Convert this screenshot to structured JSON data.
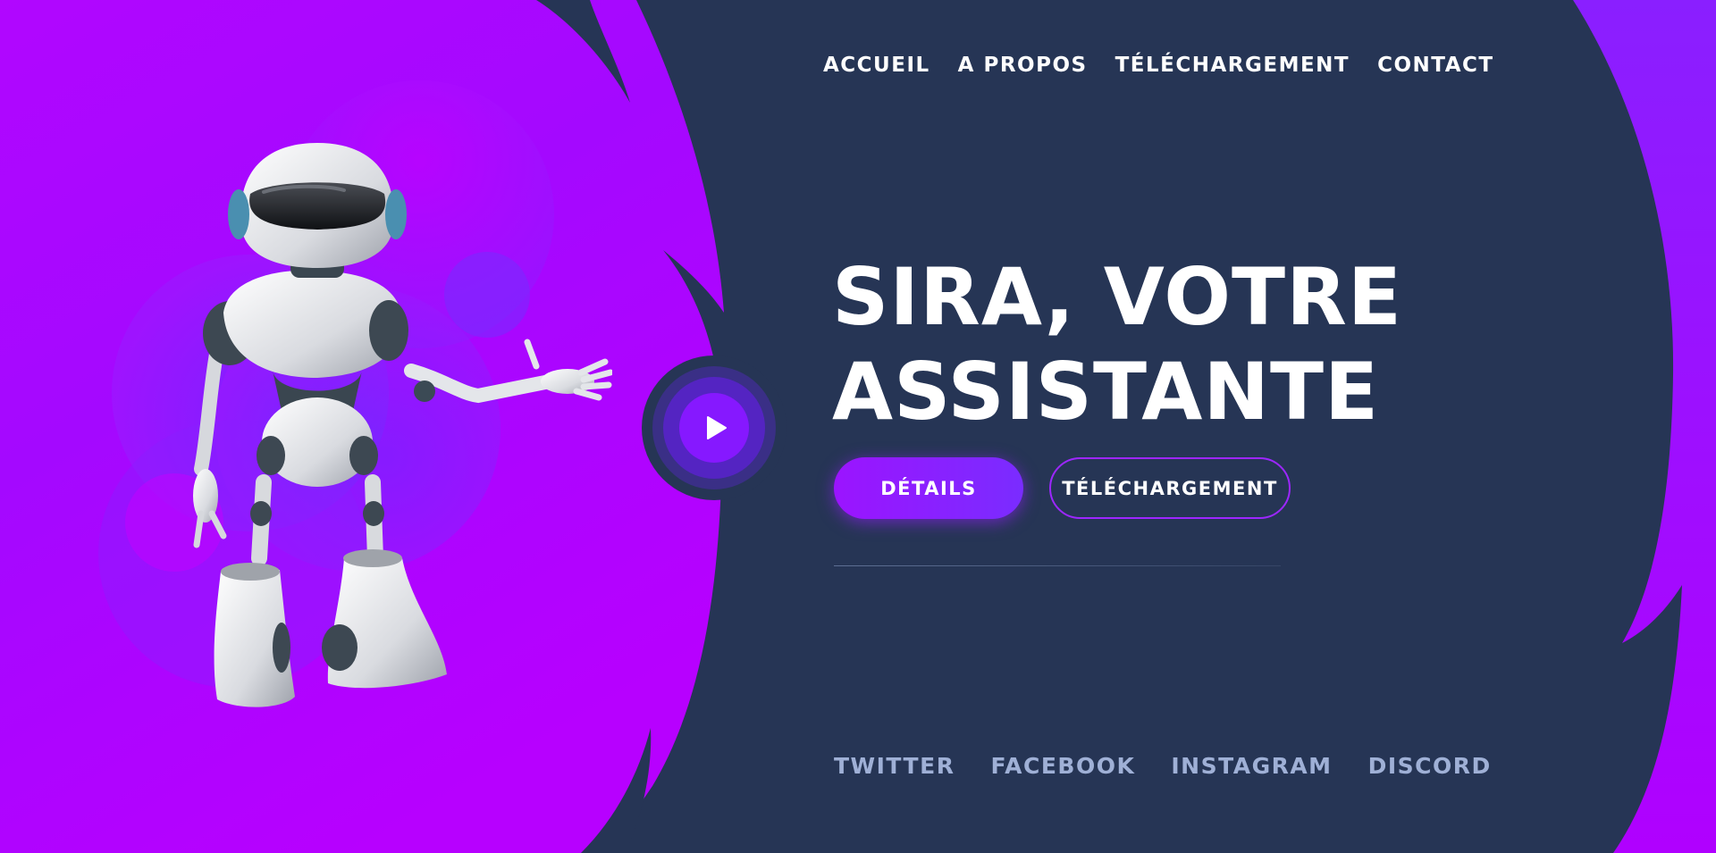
{
  "nav": {
    "items": [
      {
        "label": "ACCUEIL"
      },
      {
        "label": "A PROPOS"
      },
      {
        "label": "TÉLÉCHARGEMENT"
      },
      {
        "label": "CONTACT"
      }
    ]
  },
  "hero": {
    "title_line1": "SIRA, VOTRE",
    "title_line2": "ASSISTANTE",
    "primary_button": "DÉTAILS",
    "secondary_button": "TÉLÉCHARGEMENT"
  },
  "social": {
    "items": [
      {
        "label": "TWITTER"
      },
      {
        "label": "FACEBOOK"
      },
      {
        "label": "INSTAGRAM"
      },
      {
        "label": "DISCORD"
      }
    ]
  },
  "icons": {
    "play": "play-icon",
    "illustration": "robot-illustration"
  },
  "colors": {
    "background": "#263555",
    "magenta": "#c000ff",
    "purple": "#8a1bff",
    "accent": "#9b14ff",
    "social_text": "#9fb0d6"
  }
}
